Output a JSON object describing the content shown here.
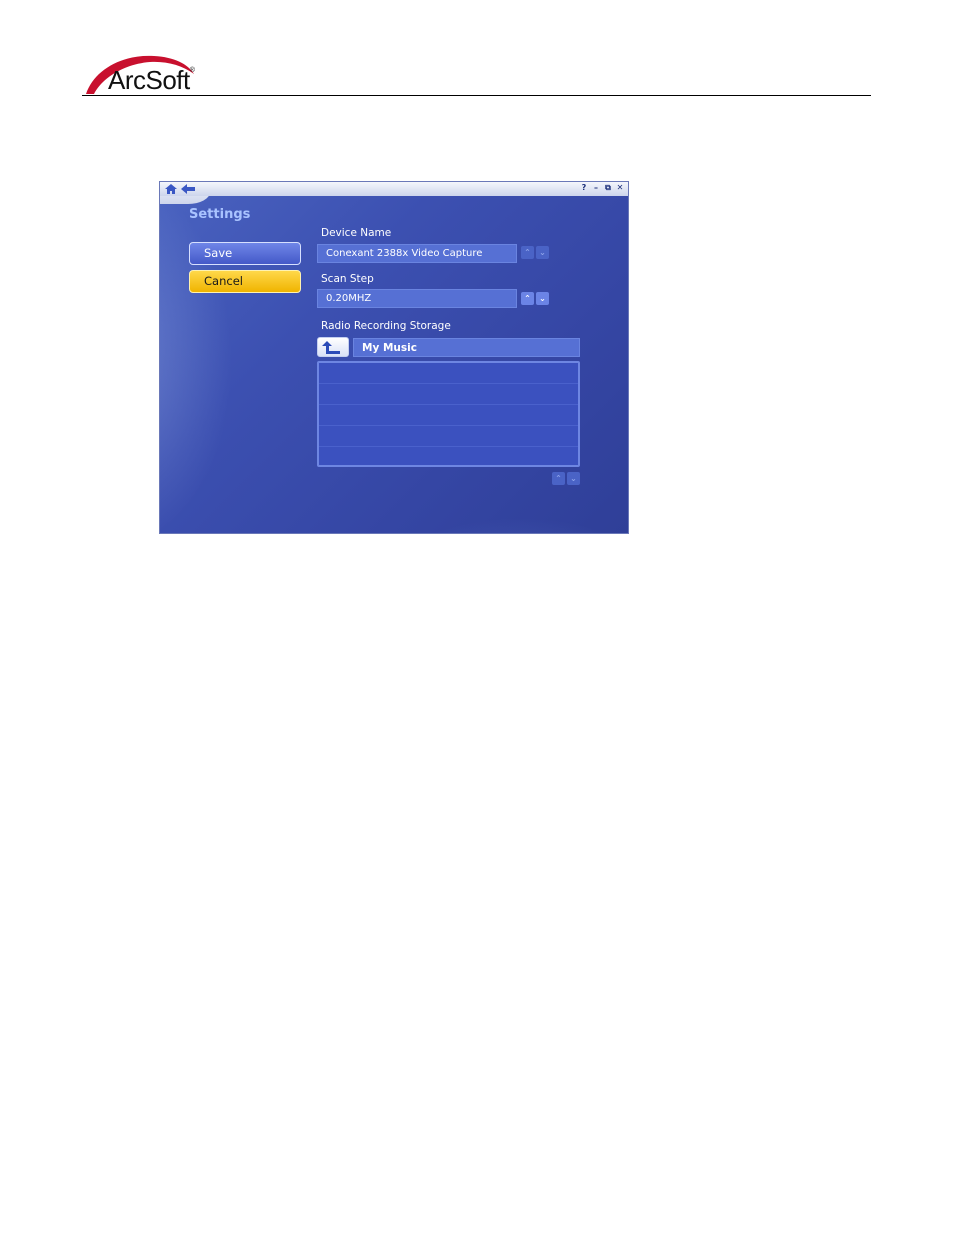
{
  "header": {
    "logo_text": "ArcSoft",
    "logo_mark": "®"
  },
  "window": {
    "titlebar": {
      "home_icon": "home-icon",
      "back_icon": "back-arrow-icon",
      "controls": [
        "?",
        "–",
        "⧉",
        "✕"
      ]
    },
    "title": "Settings",
    "buttons": {
      "save": "Save",
      "cancel": "Cancel"
    },
    "device_name": {
      "label": "Device Name",
      "value": "Conexant 2388x Video Capture"
    },
    "scan_step": {
      "label": "Scan Step",
      "value": "0.20MHZ"
    },
    "storage": {
      "label": "Radio Recording Storage",
      "path": "My Music",
      "folders": []
    },
    "colors": {
      "background": "#3c50b1",
      "field": "#5670d4",
      "save_button": "#4f66d6",
      "cancel_button": "#f5c518",
      "title_text": "#a9c3ff"
    }
  }
}
